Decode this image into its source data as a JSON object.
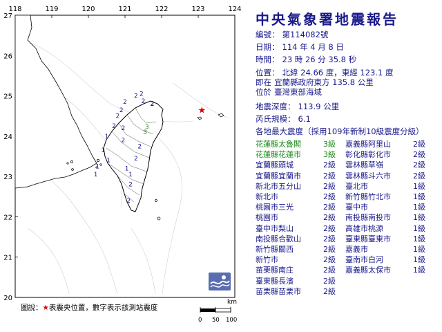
{
  "map": {
    "lon_ticks": [
      "118",
      "119",
      "120",
      "121",
      "122",
      "123",
      "124"
    ],
    "lat_ticks": [
      "27",
      "26",
      "25",
      "24",
      "23",
      "22",
      "21",
      "20"
    ],
    "epicenter_symbol": "red-star",
    "stations": [
      {
        "label": "2",
        "lon": 121.75,
        "lat": 24.76,
        "color": "#1a1a8c"
      },
      {
        "label": "2",
        "lon": 121.74,
        "lat": 24.75,
        "color": "#1a1a8c"
      },
      {
        "label": "2",
        "lon": 121.5,
        "lat": 24.82,
        "color": "#1a1a8c"
      },
      {
        "label": "2",
        "lon": 121.45,
        "lat": 25.0,
        "color": "#1a1a8c"
      },
      {
        "label": "2",
        "lon": 121.3,
        "lat": 24.95,
        "color": "#1a1a8c"
      },
      {
        "label": "2",
        "lon": 121.0,
        "lat": 24.8,
        "color": "#1a1a8c"
      },
      {
        "label": "2",
        "lon": 120.9,
        "lat": 24.6,
        "color": "#1a1a8c"
      },
      {
        "label": "2",
        "lon": 120.8,
        "lat": 24.45,
        "color": "#1a1a8c"
      },
      {
        "label": "2",
        "lon": 120.7,
        "lat": 24.2,
        "color": "#1a1a8c"
      },
      {
        "label": "2",
        "lon": 120.95,
        "lat": 24.15,
        "color": "#1a1a8c"
      },
      {
        "label": "3",
        "lon": 121.6,
        "lat": 24.18,
        "color": "#1d8a1d"
      },
      {
        "label": "3",
        "lon": 121.55,
        "lat": 24.05,
        "color": "#1d8a1d"
      },
      {
        "label": "2",
        "lon": 121.4,
        "lat": 23.7,
        "color": "#1a1a8c"
      },
      {
        "label": "2",
        "lon": 121.3,
        "lat": 23.4,
        "color": "#1a1a8c"
      },
      {
        "label": "2",
        "lon": 120.95,
        "lat": 23.85,
        "color": "#1a1a8c"
      },
      {
        "label": "1",
        "lon": 120.5,
        "lat": 23.95,
        "color": "#1a1a8c"
      },
      {
        "label": "1",
        "lon": 120.4,
        "lat": 23.6,
        "color": "#1a1a8c"
      },
      {
        "label": "1",
        "lon": 120.25,
        "lat": 23.2,
        "color": "#1a1a8c"
      },
      {
        "label": "1",
        "lon": 120.2,
        "lat": 23.0,
        "color": "#1a1a8c"
      },
      {
        "label": "1",
        "lon": 120.55,
        "lat": 23.35,
        "color": "#1a1a8c"
      },
      {
        "label": "1",
        "lon": 121.15,
        "lat": 23.0,
        "color": "#1a1a8c"
      },
      {
        "label": "1",
        "lon": 121.05,
        "lat": 23.15,
        "color": "#1a1a8c"
      },
      {
        "label": "2",
        "lon": 121.15,
        "lat": 22.75,
        "color": "#1a1a8c"
      },
      {
        "label": "2",
        "lon": 121.1,
        "lat": 22.35,
        "color": "#1a1a8c"
      }
    ]
  },
  "legend": {
    "prefix": "圖說：",
    "star": "★",
    "text": "表震央位置，數字表示該測站震度"
  },
  "scale": {
    "unit": "km",
    "labels": [
      "0",
      "50",
      "100"
    ]
  },
  "report": {
    "title": "中央氣象署地震報告",
    "lines": [
      {
        "k": "編號：",
        "v": "第114082號"
      },
      {
        "k": "日期：",
        "v": "114 年 4 月 8 日"
      },
      {
        "k": "時間：",
        "v": "23 時 26 分 35.8 秒"
      },
      {
        "k": "位置：",
        "v": "北緯 24.66 度，東經 123.1 度"
      },
      {
        "k": "即在",
        "v": "宜蘭縣政府東方 135.8 公里"
      },
      {
        "k": "位於",
        "v": "臺灣東部海域"
      },
      {
        "k": "地震深度：",
        "v": "113.9 公里"
      },
      {
        "k": "芮氏規模：",
        "v": "6.1"
      }
    ],
    "intensity_header": "各地最大震度（採用109年新制10級震度分級）",
    "intensities_left": [
      {
        "name": "花蓮縣太魯閣",
        "level": "3級",
        "color": "#1d8a1d"
      },
      {
        "name": "花蓮縣花蓮市",
        "level": "3級",
        "color": "#1d8a1d"
      },
      {
        "name": "宜蘭縣頭城",
        "level": "2級",
        "color": "#1a1a8c"
      },
      {
        "name": "宜蘭縣宜蘭市",
        "level": "2級",
        "color": "#1a1a8c"
      },
      {
        "name": "新北市五分山",
        "level": "2級",
        "color": "#1a1a8c"
      },
      {
        "name": "新北市",
        "level": "2級",
        "color": "#1a1a8c"
      },
      {
        "name": "桃園市三光",
        "level": "2級",
        "color": "#1a1a8c"
      },
      {
        "name": "桃園市",
        "level": "2級",
        "color": "#1a1a8c"
      },
      {
        "name": "臺中市梨山",
        "level": "2級",
        "color": "#1a1a8c"
      },
      {
        "name": "南投縣合歡山",
        "level": "2級",
        "color": "#1a1a8c"
      },
      {
        "name": "新竹縣關西",
        "level": "2級",
        "color": "#1a1a8c"
      },
      {
        "name": "新竹市",
        "level": "2級",
        "color": "#1a1a8c"
      },
      {
        "name": "苗栗縣南庄",
        "level": "2級",
        "color": "#1a1a8c"
      },
      {
        "name": "臺東縣長濱",
        "level": "2級",
        "color": "#1a1a8c"
      },
      {
        "name": "苗栗縣苗栗市",
        "level": "2級",
        "color": "#1a1a8c"
      }
    ],
    "intensities_right": [
      {
        "name": "嘉義縣阿里山",
        "level": "2級",
        "color": "#1a1a8c"
      },
      {
        "name": "彰化縣彰化市",
        "level": "2級",
        "color": "#1a1a8c"
      },
      {
        "name": "雲林縣草嶺",
        "level": "2級",
        "color": "#1a1a8c"
      },
      {
        "name": "雲林縣斗六市",
        "level": "2級",
        "color": "#1a1a8c"
      },
      {
        "name": "臺北市",
        "level": "1級",
        "color": "#1a1a8c"
      },
      {
        "name": "新竹縣竹北市",
        "level": "1級",
        "color": "#1a1a8c"
      },
      {
        "name": "臺中市",
        "level": "1級",
        "color": "#1a1a8c"
      },
      {
        "name": "南投縣南投市",
        "level": "1級",
        "color": "#1a1a8c"
      },
      {
        "name": "高雄市桃源",
        "level": "1級",
        "color": "#1a1a8c"
      },
      {
        "name": "臺東縣臺東市",
        "level": "1級",
        "color": "#1a1a8c"
      },
      {
        "name": "嘉義市",
        "level": "1級",
        "color": "#1a1a8c"
      },
      {
        "name": "臺南市白河",
        "level": "1級",
        "color": "#1a1a8c"
      },
      {
        "name": "嘉義縣太保市",
        "level": "1級",
        "color": "#1a1a8c"
      }
    ]
  }
}
